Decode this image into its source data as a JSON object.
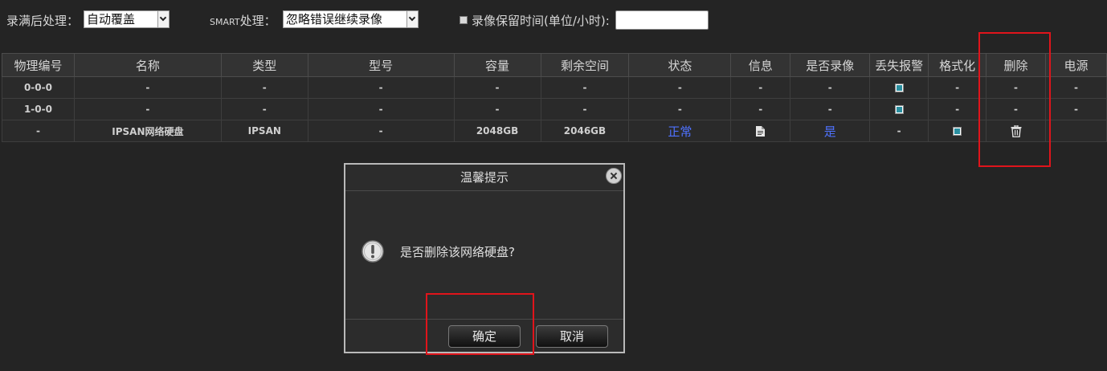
{
  "options": {
    "overwrite_label": "录满后处理：",
    "overwrite_value": "自动覆盖",
    "smart_label_prefix": "SMART",
    "smart_label_suffix": "处理：",
    "smart_value": "忽略错误继续录像",
    "retention_label": "录像保留时间(单位/小时):",
    "retention_value": ""
  },
  "table": {
    "headers": [
      "物理编号",
      "名称",
      "类型",
      "型号",
      "容量",
      "剩余空间",
      "状态",
      "信息",
      "是否录像",
      "丢失报警",
      "格式化",
      "删除",
      "电源"
    ],
    "rows": [
      {
        "id": "0-0-0",
        "name": "-",
        "type": "-",
        "model": "-",
        "capacity": "-",
        "free": "-",
        "status": "-",
        "info": "-",
        "recording": "-",
        "lost_alarm_checked": true,
        "format": "-",
        "delete": "-",
        "power": "-"
      },
      {
        "id": "1-0-0",
        "name": "-",
        "type": "-",
        "model": "-",
        "capacity": "-",
        "free": "-",
        "status": "-",
        "info": "-",
        "recording": "-",
        "lost_alarm_checked": true,
        "format": "-",
        "delete": "-",
        "power": "-"
      },
      {
        "id": "-",
        "name": "IPSAN网络硬盘",
        "type": "IPSAN",
        "model": "-",
        "capacity": "2048GB",
        "free": "2046GB",
        "status": "正常",
        "info_icon": "document-icon",
        "recording": "是",
        "lost_alarm": "-",
        "format_checked": true,
        "delete_icon": "trash-icon",
        "power": ""
      }
    ]
  },
  "dialog": {
    "title": "温馨提示",
    "message": "是否删除该网络硬盘?",
    "confirm": "确定",
    "cancel": "取消",
    "icon": "warning-icon"
  },
  "colors": {
    "background": "#242424",
    "link": "#4f72ff",
    "highlight": "#e0141b"
  }
}
